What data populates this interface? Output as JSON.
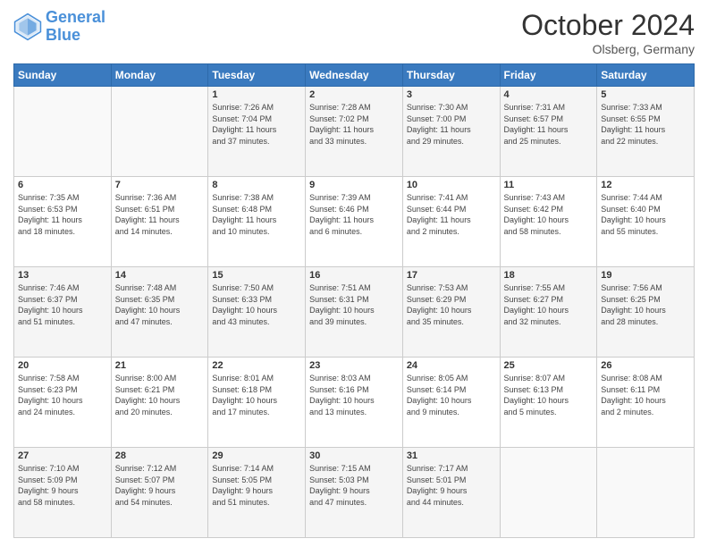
{
  "header": {
    "logo_line1": "General",
    "logo_line2": "Blue",
    "month": "October 2024",
    "location": "Olsberg, Germany"
  },
  "days_of_week": [
    "Sunday",
    "Monday",
    "Tuesday",
    "Wednesday",
    "Thursday",
    "Friday",
    "Saturday"
  ],
  "weeks": [
    [
      {
        "day": "",
        "info": ""
      },
      {
        "day": "",
        "info": ""
      },
      {
        "day": "1",
        "info": "Sunrise: 7:26 AM\nSunset: 7:04 PM\nDaylight: 11 hours\nand 37 minutes."
      },
      {
        "day": "2",
        "info": "Sunrise: 7:28 AM\nSunset: 7:02 PM\nDaylight: 11 hours\nand 33 minutes."
      },
      {
        "day": "3",
        "info": "Sunrise: 7:30 AM\nSunset: 7:00 PM\nDaylight: 11 hours\nand 29 minutes."
      },
      {
        "day": "4",
        "info": "Sunrise: 7:31 AM\nSunset: 6:57 PM\nDaylight: 11 hours\nand 25 minutes."
      },
      {
        "day": "5",
        "info": "Sunrise: 7:33 AM\nSunset: 6:55 PM\nDaylight: 11 hours\nand 22 minutes."
      }
    ],
    [
      {
        "day": "6",
        "info": "Sunrise: 7:35 AM\nSunset: 6:53 PM\nDaylight: 11 hours\nand 18 minutes."
      },
      {
        "day": "7",
        "info": "Sunrise: 7:36 AM\nSunset: 6:51 PM\nDaylight: 11 hours\nand 14 minutes."
      },
      {
        "day": "8",
        "info": "Sunrise: 7:38 AM\nSunset: 6:48 PM\nDaylight: 11 hours\nand 10 minutes."
      },
      {
        "day": "9",
        "info": "Sunrise: 7:39 AM\nSunset: 6:46 PM\nDaylight: 11 hours\nand 6 minutes."
      },
      {
        "day": "10",
        "info": "Sunrise: 7:41 AM\nSunset: 6:44 PM\nDaylight: 11 hours\nand 2 minutes."
      },
      {
        "day": "11",
        "info": "Sunrise: 7:43 AM\nSunset: 6:42 PM\nDaylight: 10 hours\nand 58 minutes."
      },
      {
        "day": "12",
        "info": "Sunrise: 7:44 AM\nSunset: 6:40 PM\nDaylight: 10 hours\nand 55 minutes."
      }
    ],
    [
      {
        "day": "13",
        "info": "Sunrise: 7:46 AM\nSunset: 6:37 PM\nDaylight: 10 hours\nand 51 minutes."
      },
      {
        "day": "14",
        "info": "Sunrise: 7:48 AM\nSunset: 6:35 PM\nDaylight: 10 hours\nand 47 minutes."
      },
      {
        "day": "15",
        "info": "Sunrise: 7:50 AM\nSunset: 6:33 PM\nDaylight: 10 hours\nand 43 minutes."
      },
      {
        "day": "16",
        "info": "Sunrise: 7:51 AM\nSunset: 6:31 PM\nDaylight: 10 hours\nand 39 minutes."
      },
      {
        "day": "17",
        "info": "Sunrise: 7:53 AM\nSunset: 6:29 PM\nDaylight: 10 hours\nand 35 minutes."
      },
      {
        "day": "18",
        "info": "Sunrise: 7:55 AM\nSunset: 6:27 PM\nDaylight: 10 hours\nand 32 minutes."
      },
      {
        "day": "19",
        "info": "Sunrise: 7:56 AM\nSunset: 6:25 PM\nDaylight: 10 hours\nand 28 minutes."
      }
    ],
    [
      {
        "day": "20",
        "info": "Sunrise: 7:58 AM\nSunset: 6:23 PM\nDaylight: 10 hours\nand 24 minutes."
      },
      {
        "day": "21",
        "info": "Sunrise: 8:00 AM\nSunset: 6:21 PM\nDaylight: 10 hours\nand 20 minutes."
      },
      {
        "day": "22",
        "info": "Sunrise: 8:01 AM\nSunset: 6:18 PM\nDaylight: 10 hours\nand 17 minutes."
      },
      {
        "day": "23",
        "info": "Sunrise: 8:03 AM\nSunset: 6:16 PM\nDaylight: 10 hours\nand 13 minutes."
      },
      {
        "day": "24",
        "info": "Sunrise: 8:05 AM\nSunset: 6:14 PM\nDaylight: 10 hours\nand 9 minutes."
      },
      {
        "day": "25",
        "info": "Sunrise: 8:07 AM\nSunset: 6:13 PM\nDaylight: 10 hours\nand 5 minutes."
      },
      {
        "day": "26",
        "info": "Sunrise: 8:08 AM\nSunset: 6:11 PM\nDaylight: 10 hours\nand 2 minutes."
      }
    ],
    [
      {
        "day": "27",
        "info": "Sunrise: 7:10 AM\nSunset: 5:09 PM\nDaylight: 9 hours\nand 58 minutes."
      },
      {
        "day": "28",
        "info": "Sunrise: 7:12 AM\nSunset: 5:07 PM\nDaylight: 9 hours\nand 54 minutes."
      },
      {
        "day": "29",
        "info": "Sunrise: 7:14 AM\nSunset: 5:05 PM\nDaylight: 9 hours\nand 51 minutes."
      },
      {
        "day": "30",
        "info": "Sunrise: 7:15 AM\nSunset: 5:03 PM\nDaylight: 9 hours\nand 47 minutes."
      },
      {
        "day": "31",
        "info": "Sunrise: 7:17 AM\nSunset: 5:01 PM\nDaylight: 9 hours\nand 44 minutes."
      },
      {
        "day": "",
        "info": ""
      },
      {
        "day": "",
        "info": ""
      }
    ]
  ]
}
